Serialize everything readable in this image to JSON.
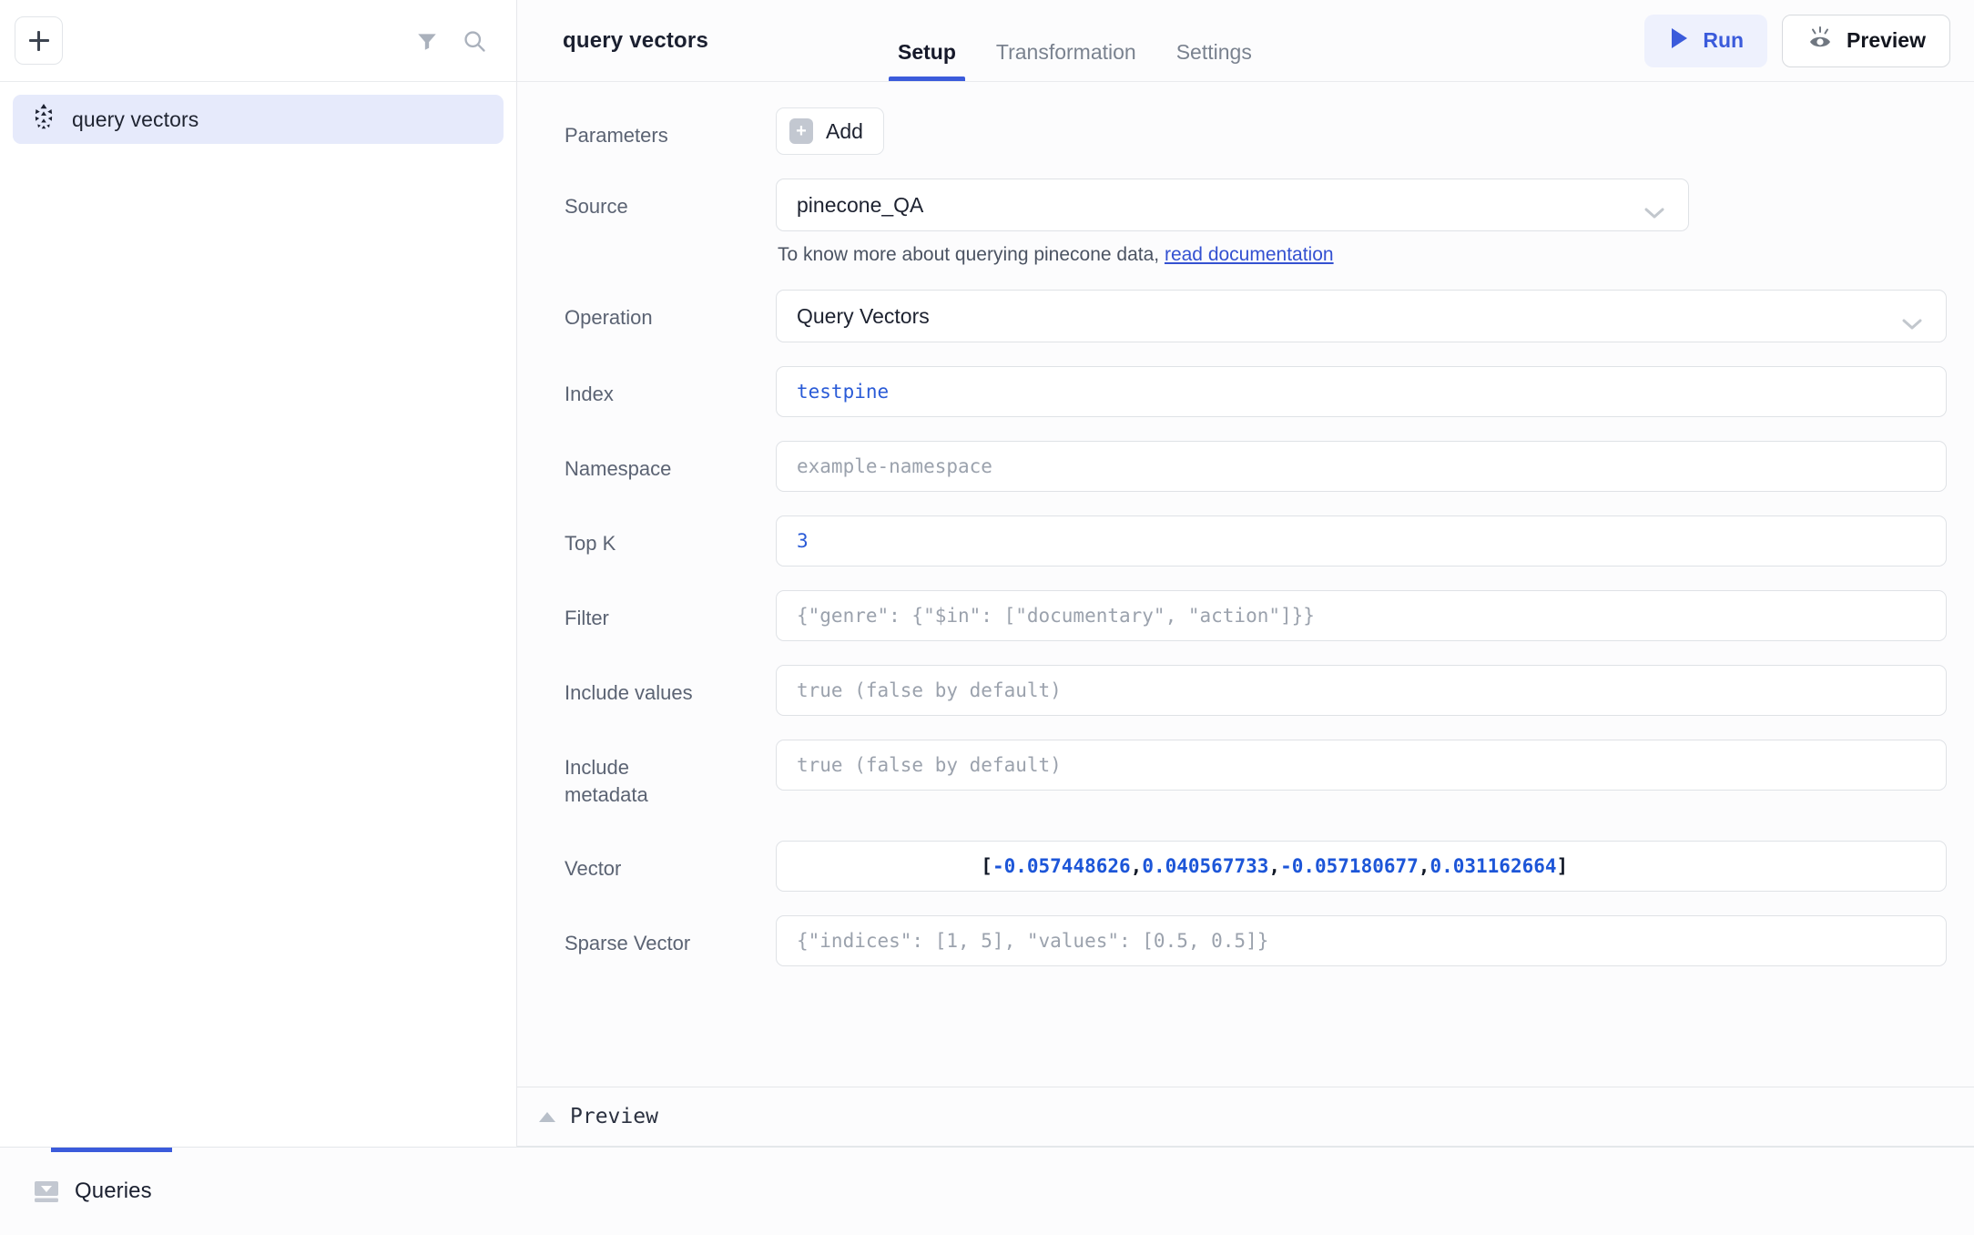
{
  "sidebar": {
    "add_button_label": "+",
    "icons": {
      "filter": "filter-icon",
      "search": "search-icon"
    },
    "items": [
      {
        "label": "query vectors",
        "icon": "pinecone-logo-icon",
        "selected": true
      }
    ]
  },
  "topbar": {
    "title": "query vectors",
    "tabs": [
      {
        "label": "Setup",
        "active": true
      },
      {
        "label": "Transformation",
        "active": false
      },
      {
        "label": "Settings",
        "active": false
      }
    ],
    "run_label": "Run",
    "preview_label": "Preview"
  },
  "form": {
    "parameters": {
      "label": "Parameters",
      "add_label": "Add",
      "add_plus": "+"
    },
    "source": {
      "label": "Source",
      "value": "pinecone_QA",
      "helper_prefix": "To know more about querying pinecone data, ",
      "helper_link": "read documentation"
    },
    "operation": {
      "label": "Operation",
      "value": "Query Vectors"
    },
    "index": {
      "label": "Index",
      "value": "testpine"
    },
    "namespace": {
      "label": "Namespace",
      "placeholder": "example-namespace"
    },
    "top_k": {
      "label": "Top K",
      "value": "3"
    },
    "filter": {
      "label": "Filter",
      "placeholder": "{\"genre\": {\"$in\": [\"documentary\", \"action\"]}}"
    },
    "include_values": {
      "label": "Include values",
      "placeholder": "true (false by default)"
    },
    "include_metadata": {
      "label": "Include metadata",
      "placeholder": "true (false by default)"
    },
    "vector": {
      "label": "Vector",
      "open_bracket": "[",
      "close_bracket": "]",
      "comma": ",",
      "values": [
        "-0.057448626",
        "0.040567733",
        "-0.057180677",
        "0.031162664"
      ]
    },
    "sparse_vector": {
      "label": "Sparse Vector",
      "placeholder": "{\"indices\": [1, 5], \"values\": [0.5, 0.5]}"
    }
  },
  "preview_panel": {
    "label": "Preview",
    "collapse_icon": "triangle-up-icon"
  },
  "footer": {
    "queries_label": "Queries",
    "queries_icon": "queries-panel-icon"
  },
  "colors": {
    "accent_blue": "#3b5bdb",
    "run_bg": "#eef1fd",
    "selected_item_bg": "#e6eafb",
    "code_blue": "#1d56d8",
    "label_gray": "#5b6373",
    "placeholder_gray": "#9ba2ad",
    "border_gray": "#dfe2e6"
  }
}
